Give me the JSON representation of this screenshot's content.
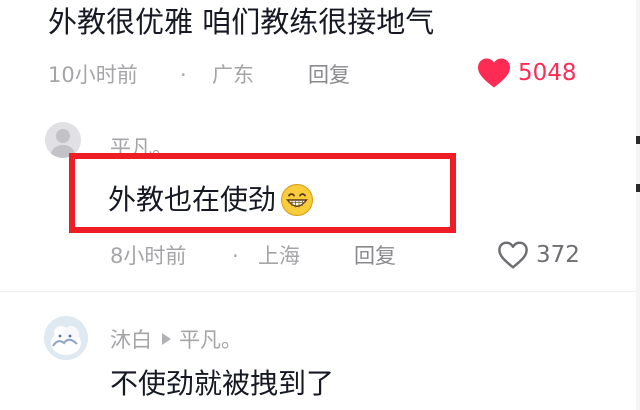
{
  "comment": {
    "text": "外教很优雅 咱们教练很接地气",
    "time": "10小时前",
    "dot": "·",
    "location": "广东",
    "reply_label": "回复",
    "likes": "5048",
    "liked": true,
    "like_color": "#fe2c55"
  },
  "replies": [
    {
      "username": "平凡。",
      "text": "外教也在使劲",
      "emoji": "grinning-face-emoji",
      "time": "8小时前",
      "dot": "·",
      "location": "上海",
      "reply_label": "回复",
      "likes": "372",
      "liked": false,
      "highlighted": true,
      "highlight_color": "#ee1c25"
    },
    {
      "username": "沐白",
      "reply_to": "平凡。",
      "text": "不使劲就被拽到了"
    }
  ],
  "icons": {
    "like_filled": "heart-filled-icon",
    "like_outline": "heart-outline-icon",
    "reply_arrow": "triangle-right-icon"
  }
}
